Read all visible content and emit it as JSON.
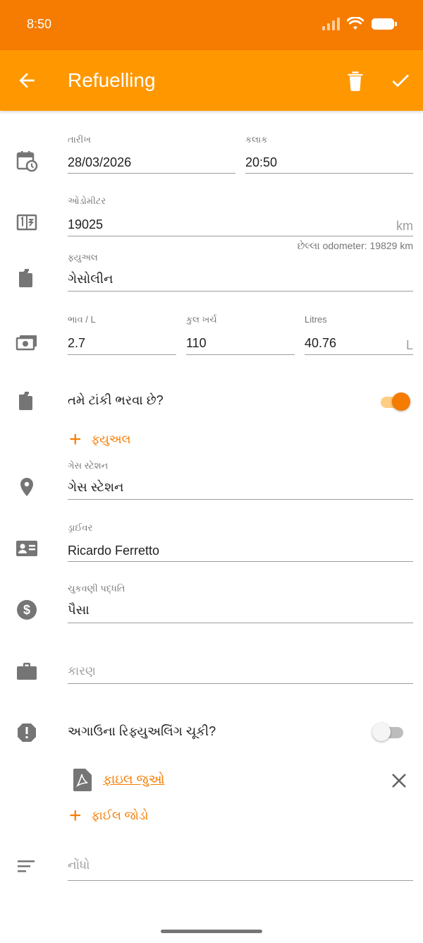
{
  "status_bar": {
    "time": "8:50"
  },
  "app_bar": {
    "title": "Refuelling"
  },
  "date_field": {
    "label": "તારીખ",
    "value": "28/03/2026"
  },
  "time_field": {
    "label": "કલાક",
    "value": "20:50"
  },
  "odometer": {
    "label": "ઓડોમીટર",
    "value": "19025",
    "unit": "km",
    "hint": "છેલ્લા odometer: 19829 km"
  },
  "fuel": {
    "label": "ફ્યુઅલ",
    "value": "ગેસોલીન"
  },
  "price": {
    "label": "ભાવ / L",
    "value": "2.7"
  },
  "total_cost": {
    "label": "કુલ ખર્ચ",
    "value": "110"
  },
  "litres": {
    "label": "Litres",
    "value": "40.76",
    "unit": "L"
  },
  "fill_tank": {
    "label": "તમે ટાંકી ભરવા છે?",
    "checked": true
  },
  "add_fuel": {
    "label": "ફ્યુઅલ"
  },
  "gas_station": {
    "label": "ગેસ સ્ટેશન",
    "value": "ગેસ સ્ટેશન"
  },
  "driver": {
    "label": "ડ્રાઈવર",
    "value": "Ricardo Ferretto"
  },
  "payment": {
    "label": "ચુકવણી પદ્ધતિ",
    "value": "પૈસા"
  },
  "reason": {
    "placeholder": "કારણ"
  },
  "missed_refuel": {
    "label": "અગાઉના રિફ્યુઅલિંગ ચૂકી?",
    "checked": false
  },
  "attachment": {
    "link": "ફાઇલ જુઓ"
  },
  "add_file": {
    "label": "ફાઈલ જોડો"
  },
  "notes": {
    "placeholder": "નોંધો"
  },
  "colors": {
    "primary": "#ff9800",
    "primary_dark": "#f57c00",
    "icon_gray": "#757575"
  },
  "icons": [
    "arrow-back-icon",
    "delete-icon",
    "check-icon",
    "calendar-clock-icon",
    "odometer-icon",
    "fuel-pump-icon",
    "money-icon",
    "location-pin-icon",
    "id-card-icon",
    "dollar-circle-icon",
    "briefcase-icon",
    "alert-octagon-icon",
    "pdf-file-icon",
    "close-icon",
    "notes-icon"
  ]
}
